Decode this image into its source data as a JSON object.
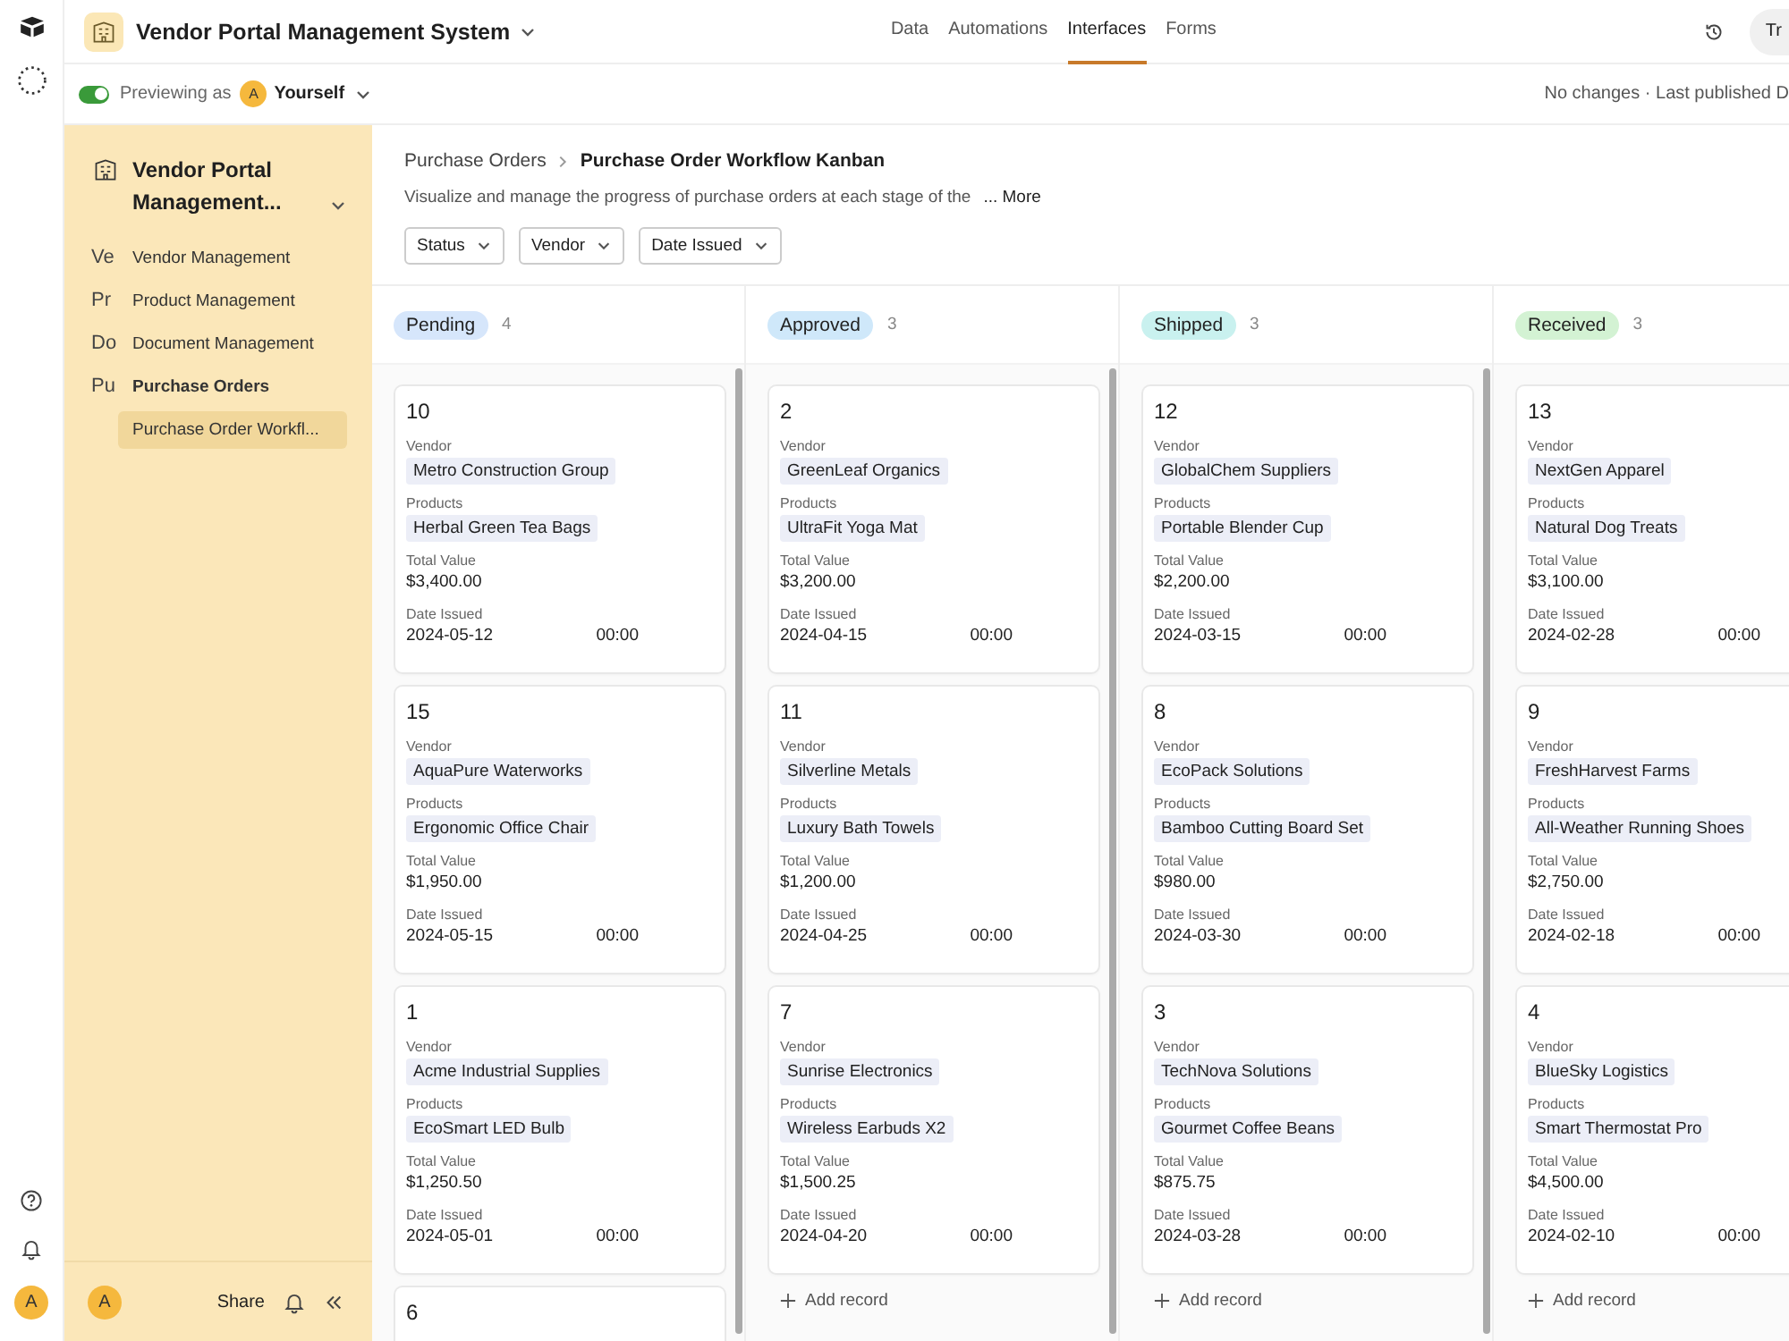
{
  "app": {
    "title": "Vendor Portal Management System",
    "tabs": [
      {
        "label": "Data",
        "selected": false
      },
      {
        "label": "Automations",
        "selected": false
      },
      {
        "label": "Interfaces",
        "selected": true
      },
      {
        "label": "Forms",
        "selected": false
      }
    ],
    "account_button": "Tr"
  },
  "preview_bar": {
    "preview_on": true,
    "label": "Previewing as",
    "avatar": "A",
    "user": "Yourself",
    "status": "No changes · Last published D"
  },
  "rail": {
    "avatar": "A"
  },
  "sidebar": {
    "title": "Vendor Portal Management...",
    "items": [
      {
        "abbr": "Ve",
        "label": "Vendor Management",
        "selected": false
      },
      {
        "abbr": "Pr",
        "label": "Product Management",
        "selected": false
      },
      {
        "abbr": "Do",
        "label": "Document Management",
        "selected": false
      },
      {
        "abbr": "Pu",
        "label": "Purchase Orders",
        "selected": true,
        "children": [
          {
            "label": "Purchase Order Workfl...",
            "selected": true
          }
        ]
      }
    ],
    "avatar": "A",
    "share": "Share"
  },
  "page": {
    "breadcrumb": [
      "Purchase Orders",
      "Purchase Order Workflow Kanban"
    ],
    "description": "Visualize and manage the progress of purchase orders at each stage of the",
    "more": "... More",
    "filters": [
      "Status",
      "Vendor",
      "Date Issued"
    ]
  },
  "board": {
    "columns": [
      {
        "status": "Pending",
        "color": "#d6e6fb",
        "count": "4",
        "cards": [
          {
            "id": "10",
            "fields": [
              [
                "Vendor",
                "Metro Construction Group"
              ],
              [
                "Products",
                "Herbal Green Tea Bags"
              ],
              [
                "Total Value",
                "$3,400.00"
              ],
              [
                "Date Issued",
                "2024-05-12",
                "00:00"
              ]
            ]
          },
          {
            "id": "15",
            "fields": [
              [
                "Vendor",
                "AquaPure Waterworks"
              ],
              [
                "Products",
                "Ergonomic Office Chair"
              ],
              [
                "Total Value",
                "$1,950.00"
              ],
              [
                "Date Issued",
                "2024-05-15",
                "00:00"
              ]
            ]
          },
          {
            "id": "1",
            "fields": [
              [
                "Vendor",
                "Acme Industrial Supplies"
              ],
              [
                "Products",
                "EcoSmart LED Bulb"
              ],
              [
                "Total Value",
                "$1,250.50"
              ],
              [
                "Date Issued",
                "2024-05-01",
                "00:00"
              ]
            ]
          },
          {
            "id": "6"
          }
        ]
      },
      {
        "status": "Approved",
        "color": "#cfe8fa",
        "count": "3",
        "add_record": "Add record",
        "cards": [
          {
            "id": "2",
            "fields": [
              [
                "Vendor",
                "GreenLeaf Organics"
              ],
              [
                "Products",
                "UltraFit Yoga Mat"
              ],
              [
                "Total Value",
                "$3,200.00"
              ],
              [
                "Date Issued",
                "2024-04-15",
                "00:00"
              ]
            ]
          },
          {
            "id": "11",
            "fields": [
              [
                "Vendor",
                "Silverline Metals"
              ],
              [
                "Products",
                "Luxury Bath Towels"
              ],
              [
                "Total Value",
                "$1,200.00"
              ],
              [
                "Date Issued",
                "2024-04-25",
                "00:00"
              ]
            ]
          },
          {
            "id": "7",
            "fields": [
              [
                "Vendor",
                "Sunrise Electronics"
              ],
              [
                "Products",
                "Wireless Earbuds X2"
              ],
              [
                "Total Value",
                "$1,500.25"
              ],
              [
                "Date Issued",
                "2024-04-20",
                "00:00"
              ]
            ]
          }
        ]
      },
      {
        "status": "Shipped",
        "color": "#c9f1ef",
        "count": "3",
        "add_record": "Add record",
        "cards": [
          {
            "id": "12",
            "fields": [
              [
                "Vendor",
                "GlobalChem Suppliers"
              ],
              [
                "Products",
                "Portable Blender Cup"
              ],
              [
                "Total Value",
                "$2,200.00"
              ],
              [
                "Date Issued",
                "2024-03-15",
                "00:00"
              ]
            ]
          },
          {
            "id": "8",
            "fields": [
              [
                "Vendor",
                "EcoPack Solutions"
              ],
              [
                "Products",
                "Bamboo Cutting Board Set"
              ],
              [
                "Total Value",
                "$980.00"
              ],
              [
                "Date Issued",
                "2024-03-30",
                "00:00"
              ]
            ]
          },
          {
            "id": "3",
            "fields": [
              [
                "Vendor",
                "TechNova Solutions"
              ],
              [
                "Products",
                "Gourmet Coffee Beans"
              ],
              [
                "Total Value",
                "$875.75"
              ],
              [
                "Date Issued",
                "2024-03-28",
                "00:00"
              ]
            ]
          }
        ]
      },
      {
        "status": "Received",
        "color": "#d3f2d3",
        "count": "3",
        "add_record": "Add record",
        "cards": [
          {
            "id": "13",
            "fields": [
              [
                "Vendor",
                "NextGen Apparel"
              ],
              [
                "Products",
                "Natural Dog Treats"
              ],
              [
                "Total Value",
                "$3,100.00"
              ],
              [
                "Date Issued",
                "2024-02-28",
                "00:00"
              ]
            ]
          },
          {
            "id": "9",
            "fields": [
              [
                "Vendor",
                "FreshHarvest Farms"
              ],
              [
                "Products",
                "All-Weather Running Shoes"
              ],
              [
                "Total Value",
                "$2,750.00"
              ],
              [
                "Date Issued",
                "2024-02-18",
                "00:00"
              ]
            ]
          },
          {
            "id": "4",
            "fields": [
              [
                "Vendor",
                "BlueSky Logistics"
              ],
              [
                "Products",
                "Smart Thermostat Pro"
              ],
              [
                "Total Value",
                "$4,500.00"
              ],
              [
                "Date Issued",
                "2024-02-10",
                "00:00"
              ]
            ]
          }
        ]
      }
    ]
  }
}
